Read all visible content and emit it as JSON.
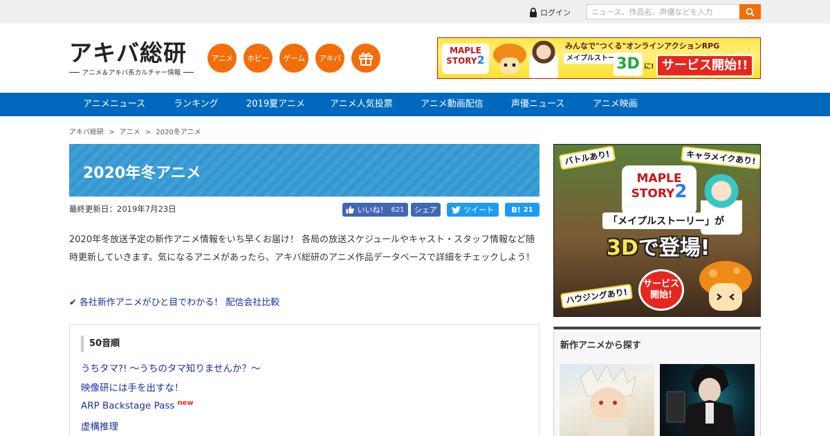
{
  "topbar": {
    "login_label": "ログイン",
    "search_placeholder": "ニュース、作品名、声優などを入力"
  },
  "header": {
    "logo_text": "アキバ総研",
    "logo_subtitle": "アニメ＆アキバ系カルチャー情報",
    "categories": [
      "アニメ",
      "ホビー",
      "ゲーム",
      "アキバ"
    ],
    "banner": {
      "text1": "みんなで\"つくる\"オンラインアクションRPG",
      "logo_line1": "MAPLE",
      "logo_line2": "STORY",
      "logo_num": "2",
      "text2_line": "メイプルストーリーが",
      "text_3d": "3D",
      "text_ni": "に!",
      "service": "サービス開始!!"
    }
  },
  "nav": {
    "items": [
      "アニメニュース",
      "ランキング",
      "2019夏アニメ",
      "アニメ人気投票",
      "アニメ動画配信",
      "声優ニュース",
      "アニメ映画"
    ]
  },
  "breadcrumb": {
    "items": [
      "アキバ総研",
      "アニメ",
      "2020冬アニメ"
    ],
    "separator": ">"
  },
  "main": {
    "title": "2020年冬アニメ",
    "updated": "最終更新日：2019年7月23日",
    "share": {
      "like_label": "いいね！",
      "like_count": "621",
      "share_label": "シェア",
      "tweet_label": "ツイート",
      "hatena_label": "B!",
      "hatena_count": "21"
    },
    "intro": "2020年冬放送予定の新作アニメ情報をいち早くお届け！ 各局の放送スケジュールやキャスト・スタッフ情報など随時更新していきます。気になるアニメがあったら、アキバ総研のアニメ作品データベースで詳細をチェックしよう！",
    "compare_check": "✔",
    "compare_link": "各社新作アニメがひと目でわかる！ 配信会社比較",
    "list_heading": "50音順",
    "list_items": [
      {
        "title": "うちタマ?! ～うちのタマ知りませんか？～",
        "badge": ""
      },
      {
        "title": "映像研には手を出すな！",
        "badge": ""
      },
      {
        "title": "ARP Backstage Pass",
        "badge": "new"
      },
      {
        "title": "虚構推理",
        "badge": ""
      }
    ]
  },
  "sidebar": {
    "banner": {
      "tag_battle": "バトルあり!",
      "tag_chara": "キャラメイクあり!",
      "logo_line1": "MAPLE",
      "logo_line2": "STORY",
      "logo_num": "2",
      "headline": "「メイプルストーリー」が",
      "big_3d": "3D",
      "big_rest": "で登場!",
      "tag_housing": "ハウジングあり!",
      "service": "サービス開始!"
    },
    "panel_heading": "新作アニメから探す"
  },
  "colors": {
    "accent_orange": "#f36d0a",
    "nav_blue": "#0069bd",
    "title_blue": "#3ea0d8",
    "link_blue": "#1a2fa0",
    "facebook": "#4267b2",
    "twitter": "#1d9bf0"
  },
  "icons": {
    "lock": "lock-icon",
    "search": "search-icon",
    "gift": "gift-icon",
    "like": "thumbs-up-icon",
    "twitter": "bird-icon"
  }
}
